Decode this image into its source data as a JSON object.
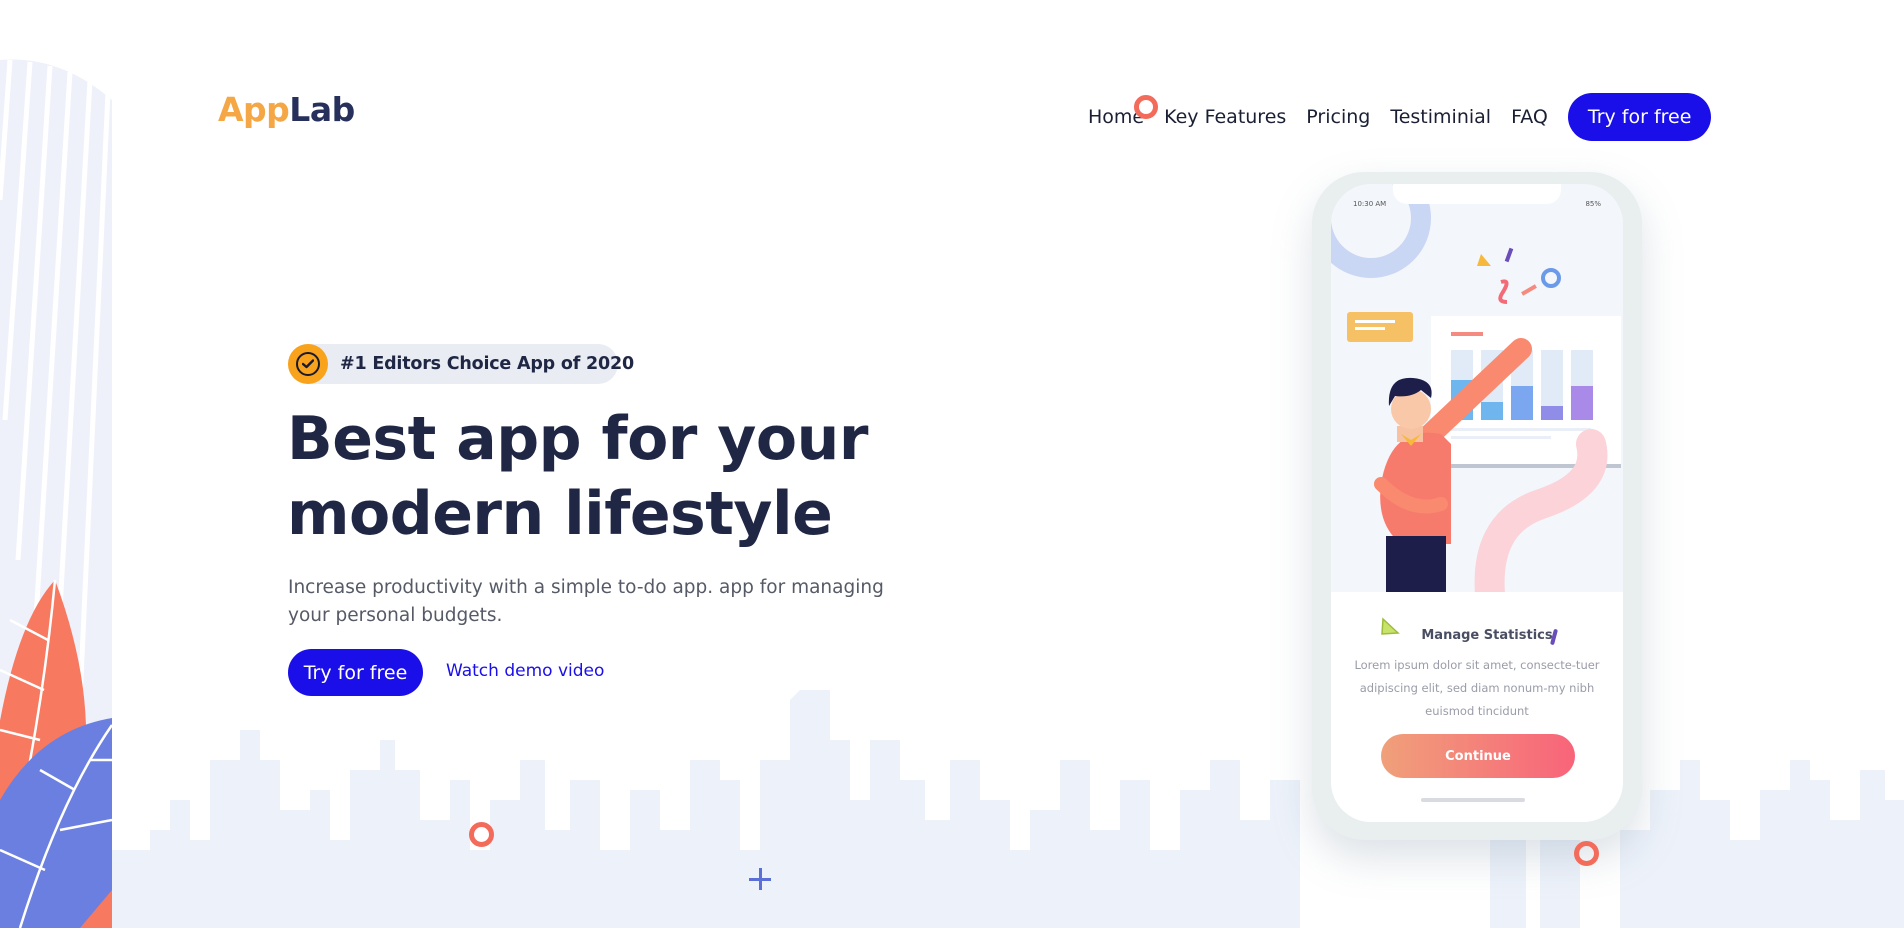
{
  "brand": {
    "logo_part1": "App",
    "logo_part2": "Lab"
  },
  "nav": {
    "items": [
      "Home",
      "Key Features",
      "Pricing",
      "Testiminial",
      "FAQ"
    ],
    "cta_label": "Try for free"
  },
  "hero": {
    "badge_text": "#1 Editors Choice App of 2020",
    "headline": "Best app for your modern lifestyle",
    "subtext": "Increase productivity with a simple to-do app. app for managing your personal budgets.",
    "cta_label": "Try for free",
    "demo_link": "Watch demo video"
  },
  "phone": {
    "status_time": "10:30 AM",
    "status_battery": "85%",
    "card_title": "Manage Statistics",
    "card_body": "Lorem ipsum dolor sit amet, consecte-tuer adipiscing elit, sed diam nonum-my nibh euismod tincidunt",
    "button_label": "Continue"
  },
  "colors": {
    "primary": "#1a0fe8",
    "navy": "#1f2745",
    "logo_orange": "#f5a745",
    "badge_yellow": "#f9a21b",
    "accent_coral": "#f26b5b",
    "skyline": "#edf2fa"
  }
}
